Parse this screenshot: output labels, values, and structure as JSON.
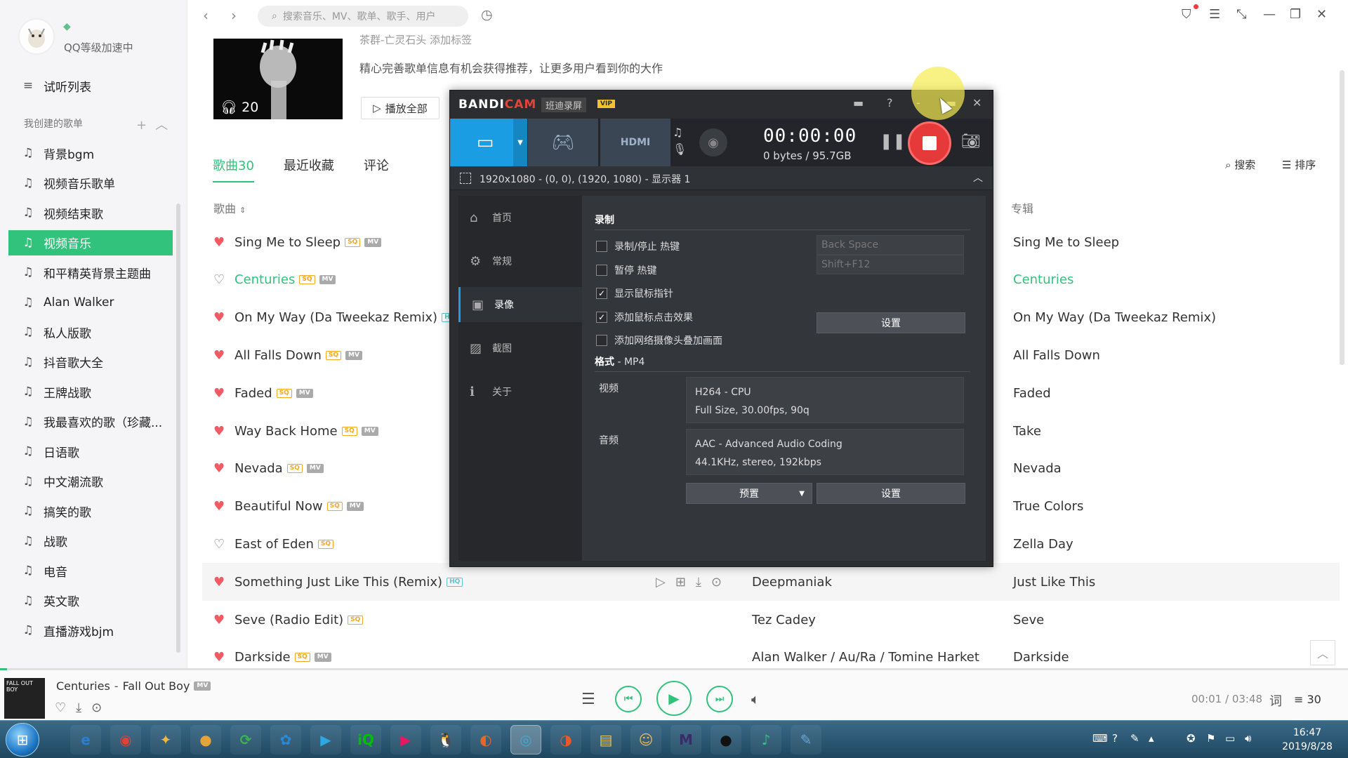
{
  "sidebar": {
    "level_text": "QQ等级加速中",
    "listen_list": "试听列表",
    "section_label": "我创建的歌单",
    "playlists": [
      "背景bgm",
      "视频音乐歌单",
      "视频结束歌",
      "视频音乐",
      "和平精英背景主题曲",
      "Alan Walker",
      "私人版歌",
      "抖音歌大全",
      "王牌战歌",
      "我最喜欢的歌（珍藏...",
      "日语歌",
      "中文潮流歌",
      "搞笑的歌",
      "战歌",
      "电音",
      "英文歌",
      "直播游戏bjm"
    ],
    "active_index": 3
  },
  "topbar": {
    "search_placeholder": "搜索音乐、MV、歌单、歌手、用户"
  },
  "header": {
    "listen_count": "20",
    "creator_line": "茶群-亡灵石头  添加标签",
    "description": "精心完善歌单信息有机会获得推荐，让更多用户看到你的大作",
    "play_all": "播放全部"
  },
  "tabs": [
    {
      "label": "歌曲30",
      "active": true
    },
    {
      "label": "最近收藏",
      "active": false
    },
    {
      "label": "评论",
      "active": false
    }
  ],
  "tab_tools": {
    "search": "搜索",
    "sort": "排序"
  },
  "columns": {
    "song": "歌曲",
    "album": "专辑"
  },
  "songs": [
    {
      "title": "Sing Me to Sleep",
      "badges": [
        "SQ",
        "MV"
      ],
      "liked": true,
      "artist": "",
      "album": "Sing Me to Sleep"
    },
    {
      "title": "Centuries",
      "badges": [
        "SQ",
        "MV"
      ],
      "liked": false,
      "playing": true,
      "artist": "",
      "album": "Centuries"
    },
    {
      "title": "On My Way (Da Tweekaz Remix)",
      "badges": [
        "HQ"
      ],
      "liked": true,
      "artist": "",
      "album": "On My Way (Da Tweekaz Remix)"
    },
    {
      "title": "All Falls Down",
      "badges": [
        "SQ",
        "MV"
      ],
      "liked": true,
      "artist": "",
      "album": "All Falls Down"
    },
    {
      "title": "Faded",
      "badges": [
        "SQ",
        "MV"
      ],
      "liked": true,
      "artist": "",
      "album": "Faded"
    },
    {
      "title": "Way Back Home",
      "badges": [
        "SQ",
        "MV"
      ],
      "liked": true,
      "artist": "",
      "album": "Take"
    },
    {
      "title": "Nevada",
      "badges": [
        "SQ",
        "MV"
      ],
      "liked": true,
      "artist": "",
      "album": "Nevada"
    },
    {
      "title": "Beautiful Now",
      "badges": [
        "SQ",
        "MV"
      ],
      "liked": true,
      "artist": "",
      "album": "True Colors"
    },
    {
      "title": "East of Eden",
      "badges": [
        "SQ"
      ],
      "liked": false,
      "artist": "",
      "album": "Zella Day"
    },
    {
      "title": "Something Just Like This (Remix)",
      "badges": [
        "HQ"
      ],
      "liked": true,
      "hover": true,
      "artist": "Deepmaniak",
      "album": "Just Like This"
    },
    {
      "title": "Seve (Radio Edit)",
      "badges": [
        "SQ"
      ],
      "liked": true,
      "artist": "Tez Cadey",
      "album": "Seve"
    },
    {
      "title": "Darkside",
      "badges": [
        "SQ",
        "MV"
      ],
      "liked": true,
      "artist": "Alan Walker / Au/Ra / Tomine Harket",
      "album": "Darkside"
    }
  ],
  "player": {
    "cover_text": "FALL OUT BOY",
    "song": "Centuries",
    "artist": "Fall Out Boy",
    "time": "00:01 / 03:48",
    "queue_count": "30",
    "progress": 0.005
  },
  "taskbar": {
    "time": "16:47",
    "date": "2019/8/28",
    "apps": [
      {
        "name": "ie",
        "glyph": "e",
        "color": "#2a7fd4"
      },
      {
        "name": "chrome",
        "glyph": "◉",
        "color": "#e34133"
      },
      {
        "name": "app-yellow",
        "glyph": "✦",
        "color": "#f2b53a"
      },
      {
        "name": "app-ball",
        "glyph": "●",
        "color": "#e8a23a"
      },
      {
        "name": "app-green",
        "glyph": "⟳",
        "color": "#3bb54a"
      },
      {
        "name": "app-flower",
        "glyph": "✿",
        "color": "#2a8ad8"
      },
      {
        "name": "app-play",
        "glyph": "▶",
        "color": "#2fa8e0"
      },
      {
        "name": "iqiyi",
        "glyph": "iQ",
        "color": "#00be06"
      },
      {
        "name": "youku",
        "glyph": "▶",
        "color": "#e5195d"
      },
      {
        "name": "qq",
        "glyph": "🐧",
        "color": "#1d95e6"
      },
      {
        "name": "firefox",
        "glyph": "◐",
        "color": "#e8662a"
      },
      {
        "name": "app-music-active",
        "glyph": "◎",
        "color": "#3fa9d9"
      },
      {
        "name": "app-orange",
        "glyph": "◑",
        "color": "#e85a2a"
      },
      {
        "name": "explorer",
        "glyph": "▤",
        "color": "#e8c45a"
      },
      {
        "name": "app-face",
        "glyph": "☺",
        "color": "#e8b85a"
      },
      {
        "name": "app-m",
        "glyph": "M",
        "color": "#3a2c6a"
      },
      {
        "name": "bandicam-rec",
        "glyph": "●",
        "color": "#111"
      },
      {
        "name": "app-leaf",
        "glyph": "♪",
        "color": "#33c27c"
      },
      {
        "name": "app-pencil",
        "glyph": "✎",
        "color": "#6aa6d6"
      }
    ]
  },
  "bandicam": {
    "logo_a": "BANDI",
    "logo_b": "CAM",
    "subtitle": "班迪录屏",
    "vip": "VIP",
    "timer": "00:00:00",
    "bytes": "0 bytes / 95.7GB",
    "region": "1920x1080 - (0, 0), (1920, 1080) - 显示器 1",
    "nav": [
      {
        "label": "首页",
        "icon": "home-icon",
        "glyph": "⌂"
      },
      {
        "label": "常规",
        "icon": "gear-icon",
        "glyph": "⚙"
      },
      {
        "label": "录像",
        "icon": "video-icon",
        "glyph": "▣",
        "active": true
      },
      {
        "label": "截图",
        "icon": "image-icon",
        "glyph": "▨"
      },
      {
        "label": "关于",
        "icon": "info-icon",
        "glyph": "ℹ"
      }
    ],
    "record_heading": "录制",
    "checks": [
      {
        "label": "录制/停止 热键",
        "checked": false
      },
      {
        "label": "暂停 热键",
        "checked": false
      },
      {
        "label": "显示鼠标指针",
        "checked": true
      },
      {
        "label": "添加鼠标点击效果",
        "checked": true
      },
      {
        "label": "添加网络摄像头叠加画面",
        "checked": false
      }
    ],
    "hotkey_record": "Back Space",
    "hotkey_pause": "Shift+F12",
    "settings_label": "设置",
    "format_heading": "格式",
    "format_value": " - MP4",
    "video_label": "视频",
    "video_line1": "H264 - CPU",
    "video_line2": "Full Size, 30.00fps, 90q",
    "audio_label": "音频",
    "audio_line1": "AAC - Advanced Audio Coding",
    "audio_line2": "44.1KHz, stereo, 192kbps",
    "preset_label": "预置"
  }
}
